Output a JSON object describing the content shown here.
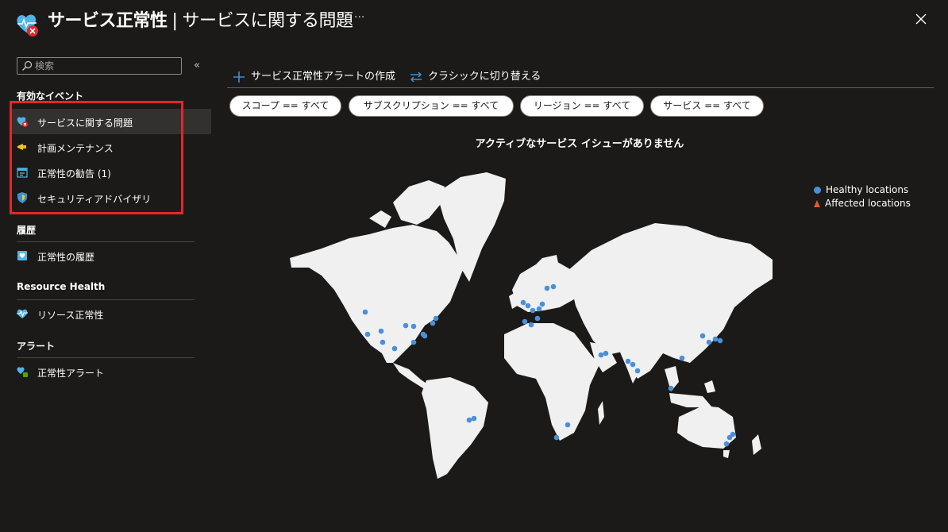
{
  "header": {
    "title": "サービス正常性",
    "separator": "|",
    "subtitle": "サービスに関する問題",
    "more": "···",
    "close_label": "×"
  },
  "sidebar": {
    "search_placeholder": "検索",
    "collapse": "«",
    "sections": [
      {
        "heading": "有効なイベント"
      },
      {
        "heading": "履歴"
      },
      {
        "heading": "Resource Health"
      },
      {
        "heading": "アラート"
      }
    ],
    "items": [
      {
        "label": "サービスに関する問題",
        "icon": "service-issues-icon",
        "selected": true
      },
      {
        "label": "計画メンテナンス",
        "icon": "megaphone-icon"
      },
      {
        "label": "正常性の勧告 (1)",
        "icon": "calendar-icon"
      },
      {
        "label": "セキュリティアドバイザリ",
        "icon": "shield-icon"
      },
      {
        "label": "正常性の履歴",
        "icon": "history-icon"
      },
      {
        "label": "リソース正常性",
        "icon": "heart-pulse-icon"
      },
      {
        "label": "正常性アラート",
        "icon": "health-alert-icon"
      }
    ]
  },
  "toolbar": {
    "create_alert": "サービス正常性アラートの作成",
    "switch_classic": "クラシックに切り替える"
  },
  "filters": [
    "スコープ == すべて",
    "サブスクリプション == すべて",
    "リージョン == すべて",
    "サービス == すべて"
  ],
  "main": {
    "no_issues": "アクティブなサービス イシューがありません"
  },
  "legend": {
    "healthy": "Healthy locations",
    "affected": "Affected locations"
  },
  "colors": {
    "background": "#1b1a19",
    "accent": "#0078d4",
    "healthy": "#4a90d9",
    "affected": "#e05a2b",
    "highlight": "#e3262d"
  }
}
